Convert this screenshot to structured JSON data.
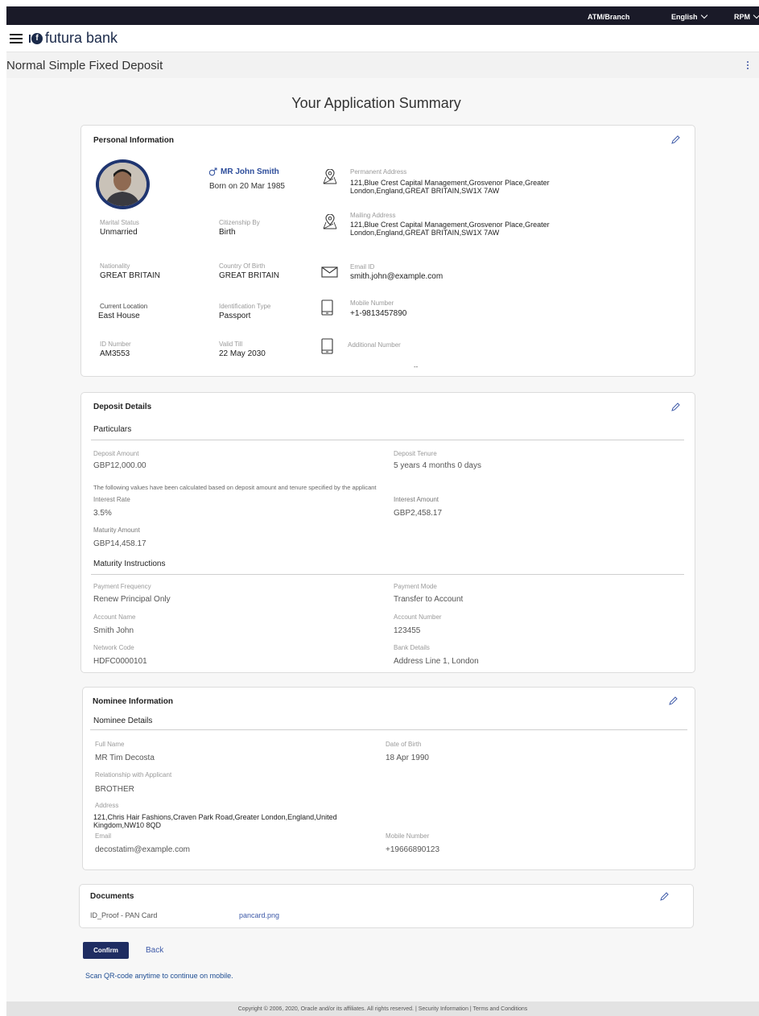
{
  "topbar": {
    "atm_branch": "ATM/Branch",
    "language": "English",
    "user": "RPM"
  },
  "header": {
    "brand": "futura bank"
  },
  "page": {
    "title": "Normal Simple Fixed Deposit",
    "summary_title": "Your Application Summary"
  },
  "personal": {
    "title": "Personal Information",
    "name": "MR John Smith",
    "born": "Born on 20 Mar 1985",
    "marital_status_label": "Marital Status",
    "marital_status": "Unmarried",
    "citizenship_label": "Citizenship By",
    "citizenship": "Birth",
    "nationality_label": "Nationality",
    "nationality": "GREAT BRITAIN",
    "country_of_birth_label": "Country Of Birth",
    "country_of_birth": "GREAT BRITAIN",
    "current_location_label": "Current Location",
    "current_location": "East House",
    "identification_type_label": "Identification Type",
    "identification_type": "Passport",
    "id_number_label": "ID Number",
    "id_number": "AM3553",
    "valid_till_label": "Valid Till",
    "valid_till": "22 May 2030",
    "permanent_address_label": "Permanent Address",
    "permanent_address": "121,Blue Crest Capital Management,Grosvenor Place,Greater London,England,GREAT BRITAIN,SW1X 7AW",
    "mailing_address_label": "Mailing Address",
    "mailing_address": "121,Blue Crest Capital Management,Grosvenor Place,Greater London,England,GREAT BRITAIN,SW1X 7AW",
    "email_label": "Email ID",
    "email": "smith.john@example.com",
    "mobile_label": "Mobile Number",
    "mobile": "+1-9813457890",
    "additional_label": "Additional Number",
    "additional": "--"
  },
  "deposit": {
    "title": "Deposit Details",
    "particulars": "Particulars",
    "amount_label": "Deposit Amount",
    "amount": "GBP12,000.00",
    "tenure_label": "Deposit Tenure",
    "tenure": "5 years 4 months 0 days",
    "note": "The following values have been calculated based on deposit amount and tenure specified by the applicant",
    "rate_label": "Interest Rate",
    "rate": "3.5%",
    "interest_label": "Interest Amount",
    "interest": "GBP2,458.17",
    "maturity_label": "Maturity Amount",
    "maturity": "GBP14,458.17",
    "instructions": "Maturity Instructions",
    "frequency_label": "Payment Frequency",
    "frequency": "Renew Principal Only",
    "mode_label": "Payment Mode",
    "mode": "Transfer to Account",
    "acc_name_label": "Account Name",
    "acc_name": "Smith John",
    "acc_number_label": "Account Number",
    "acc_number": "123455",
    "network_label": "Network Code",
    "network": "HDFC0000101",
    "bank_label": "Bank Details",
    "bank": "Address Line 1, London"
  },
  "nominee": {
    "title": "Nominee Information",
    "details": "Nominee Details",
    "full_name_label": "Full Name",
    "full_name": "MR Tim Decosta",
    "dob_label": "Date of Birth",
    "dob": "18 Apr 1990",
    "relationship_label": "Relationship with Applicant",
    "relationship": "BROTHER",
    "address_label": "Address",
    "address": "121,Chris Hair Fashions,Craven Park Road,Greater London,England,United Kingdom,NW10 8QD",
    "email_label": "Email",
    "email": "decostatim@example.com",
    "mobile_label": "Mobile Number",
    "mobile": "+19666890123"
  },
  "documents": {
    "title": "Documents",
    "doc_type": "ID_Proof - PAN Card",
    "file": "pancard.png"
  },
  "actions": {
    "confirm": "Confirm",
    "back": "Back",
    "qr": "Scan QR-code anytime to continue on mobile."
  },
  "footer": {
    "text": "Copyright © 2006, 2020, Oracle and/or its affiliates. All rights reserved. | Security Information | Terms and Conditions"
  },
  "colors": {
    "topbar": "#1a1a28",
    "brand": "#1b2a4a",
    "accent": "#3e5aa8",
    "button": "#1f2d62"
  }
}
